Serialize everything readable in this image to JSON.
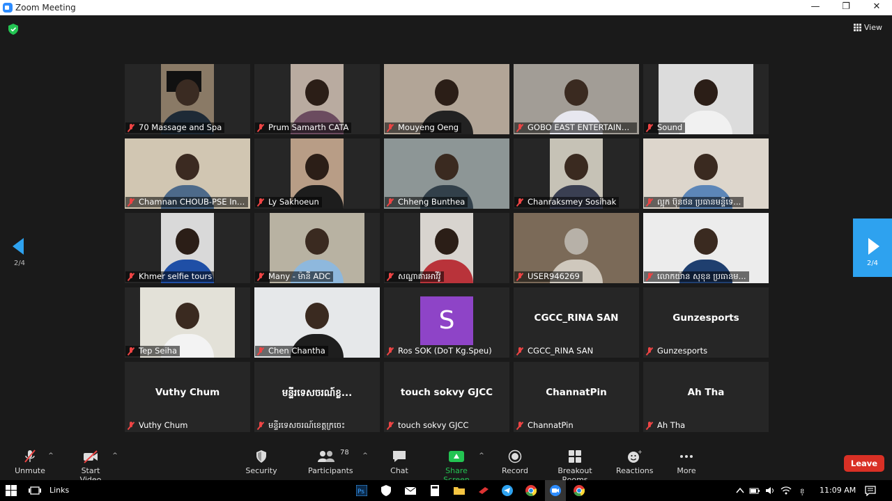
{
  "window": {
    "title": "Zoom Meeting",
    "minimize": "—",
    "restore": "❐",
    "close": "✕"
  },
  "top": {
    "view_label": "View"
  },
  "pager": {
    "left_label": "2/4",
    "right_label": "2/4"
  },
  "tiles": [
    {
      "name": "70 Massage and Spa",
      "kind": "video"
    },
    {
      "name": "Prum Samarth CATA",
      "kind": "video"
    },
    {
      "name": "Mouyeng Oeng",
      "kind": "video"
    },
    {
      "name": "GOBO EAST ENTERTAINME...",
      "kind": "video"
    },
    {
      "name": "Sound",
      "kind": "video"
    },
    {
      "name": "Chamnan CHOUB-PSE Instit...",
      "kind": "video"
    },
    {
      "name": "Ly Sakhoeun",
      "kind": "video"
    },
    {
      "name": "Chheng Bunthea",
      "kind": "video"
    },
    {
      "name": "Chanraksmey Sosihak",
      "kind": "video"
    },
    {
      "name": "ល្អុក ប៊ុនថន ប្រធានមន្ទីទេ...",
      "kind": "video"
    },
    {
      "name": "Khmer selfie tours",
      "kind": "video"
    },
    {
      "name": "Many - ម៉ានី ADC",
      "kind": "video"
    },
    {
      "name": "សណ្ឋាគារអាវីវ៉ូ",
      "kind": "video"
    },
    {
      "name": "USER946269",
      "kind": "video"
    },
    {
      "name": "លោកយ៉ាន សុខុន ប្រធានម...",
      "kind": "video"
    },
    {
      "name": "Tep Seiha",
      "kind": "video"
    },
    {
      "name": "Chen Chantha",
      "kind": "video"
    },
    {
      "name": "Ros SOK (DoT Kg.Speu)",
      "kind": "avatar",
      "initial": "S"
    },
    {
      "name": "CGCC_RINA SAN",
      "kind": "text",
      "display": "CGCC_RINA SAN"
    },
    {
      "name": "Gunzesports",
      "kind": "text",
      "display": "Gunzesports"
    },
    {
      "name": "Vuthy Chum",
      "kind": "text",
      "display": "Vuthy Chum"
    },
    {
      "name": "មន្ទីរទេសចរណ៍ខេត្តក្រចេះ",
      "kind": "text",
      "display": "មន្ទីរទេសចរណ៍ខ្ល..."
    },
    {
      "name": "touch sokvy GJCC",
      "kind": "text",
      "display": "touch sokvy GJCC"
    },
    {
      "name": "ChannatPin",
      "kind": "text",
      "display": "ChannatPin"
    },
    {
      "name": "Ah Tha",
      "kind": "text",
      "display": "Ah Tha"
    }
  ],
  "toolbar": {
    "unmute": "Unmute",
    "start_video": "Start Video",
    "security": "Security",
    "participants": "Participants",
    "participants_count": "78",
    "chat": "Chat",
    "share_screen": "Share Screen",
    "record": "Record",
    "breakout_rooms": "Breakout Rooms",
    "reactions": "Reactions",
    "more": "More",
    "leave": "Leave",
    "caret": "^"
  },
  "taskbar": {
    "links": "Links",
    "time": "11:09 AM"
  },
  "colors": {
    "accent_blue": "#2ea2ef",
    "share_green": "#23c452",
    "leave_red": "#d93025",
    "avatar_purple": "#8e44c7"
  }
}
